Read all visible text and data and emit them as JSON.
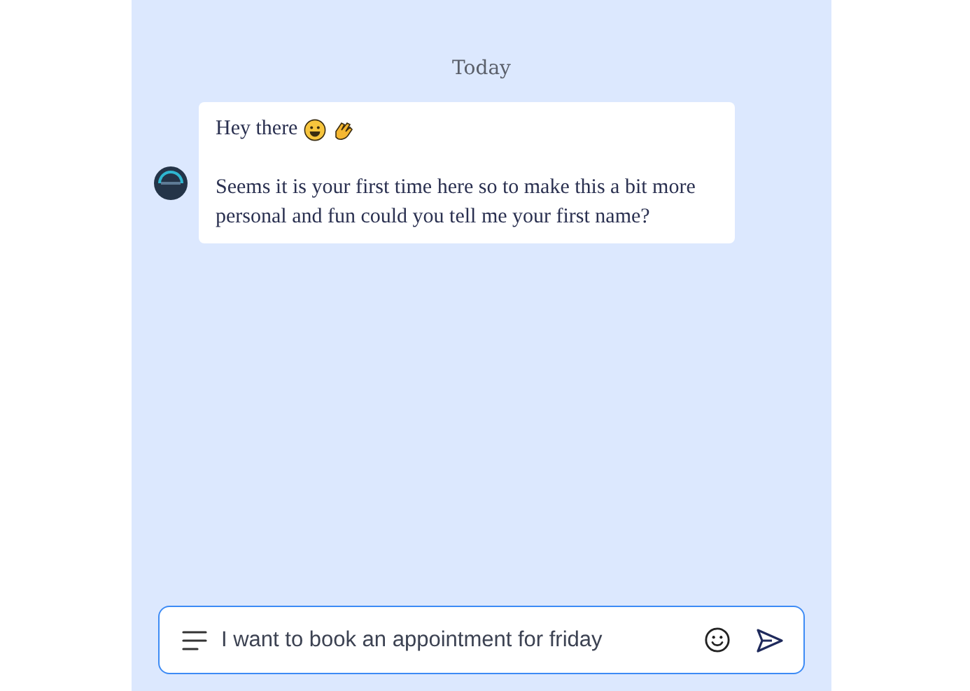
{
  "date_divider": "Today",
  "message": {
    "greeting": "Hey there",
    "body": "Seems it is your first time here so to make this a bit more personal and fun could you tell me your first name?"
  },
  "composer": {
    "value": "I want to book an appointment for friday"
  }
}
